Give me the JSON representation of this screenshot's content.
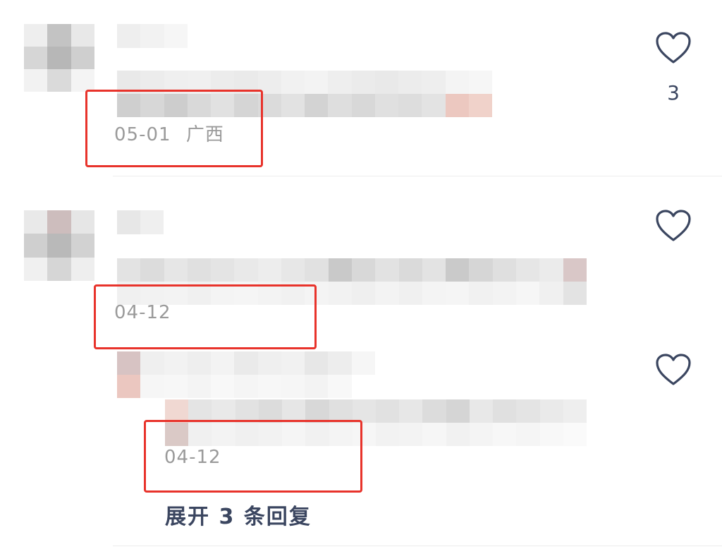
{
  "comments": [
    {
      "date": "05-01",
      "location": "广西",
      "like_count": "3",
      "icons": {
        "like": "heart-outline-icon"
      }
    },
    {
      "date": "04-12",
      "location": "",
      "like_count": "",
      "icons": {
        "like": "heart-outline-icon"
      },
      "replies": [
        {
          "date": "04-12",
          "location": "",
          "like_count": "",
          "icons": {
            "like": "heart-outline-icon"
          }
        }
      ],
      "expand_label": "展开 3 条回复"
    }
  ],
  "colors": {
    "meta_text": "#9a9a9a",
    "highlight_box": "#e8332b",
    "accent_text": "#3b4660",
    "divider": "#ececec"
  }
}
